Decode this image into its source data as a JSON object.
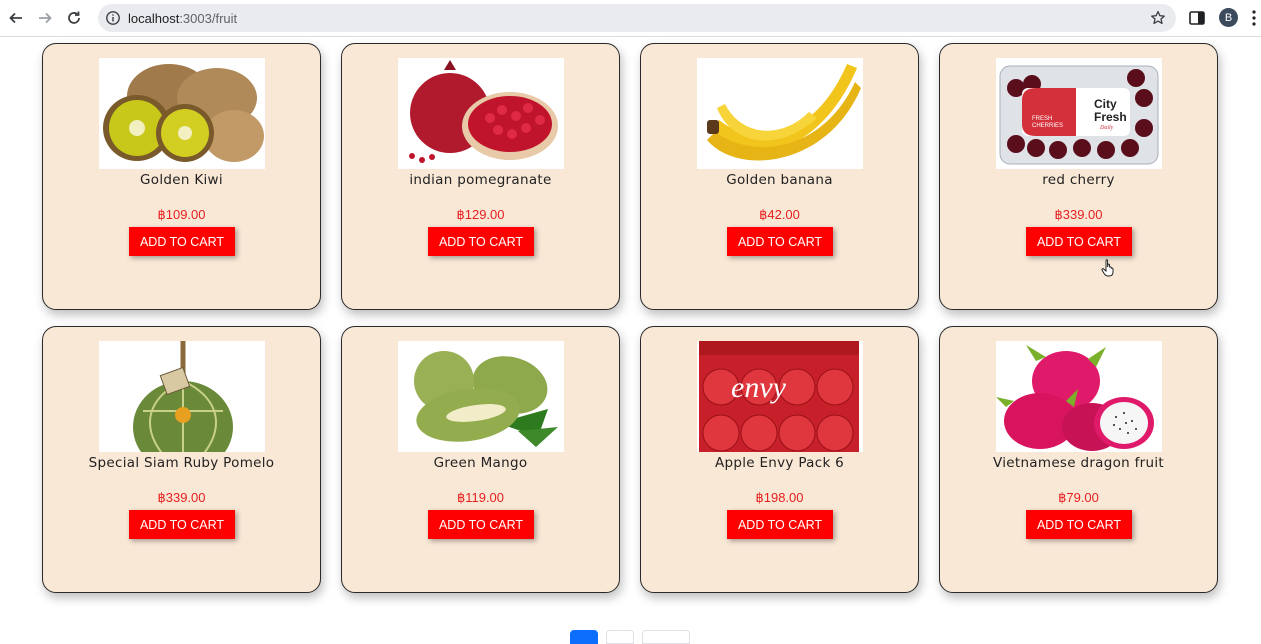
{
  "browser": {
    "url_host": "localhost",
    "url_rest": ":3003/fruit",
    "profile_initial": "B"
  },
  "products": [
    {
      "name": "Golden Kiwi",
      "price": "฿109.00",
      "button": "ADD TO CART",
      "image": "kiwi"
    },
    {
      "name": "indian pomegranate",
      "price": "฿129.00",
      "button": "ADD TO CART",
      "image": "pomegranate"
    },
    {
      "name": "Golden banana",
      "price": "฿42.00",
      "button": "ADD TO CART",
      "image": "banana"
    },
    {
      "name": "red cherry",
      "price": "฿339.00",
      "button": "ADD TO CART",
      "image": "cherry-pack"
    },
    {
      "name": "Special Siam Ruby Pomelo",
      "price": "฿339.00",
      "button": "ADD TO CART",
      "image": "pomelo"
    },
    {
      "name": "Green Mango",
      "price": "฿119.00",
      "button": "ADD TO CART",
      "image": "mango"
    },
    {
      "name": "Apple Envy Pack 6",
      "price": "฿198.00",
      "button": "ADD TO CART",
      "image": "apple-pack"
    },
    {
      "name": "Vietnamese dragon fruit",
      "price": "฿79.00",
      "button": "ADD TO CART",
      "image": "dragon-fruit"
    }
  ],
  "cherry_label": {
    "brand_line1": "City",
    "brand_line2": "Fresh",
    "brand_line3": "Daily",
    "tag_line1": "FRESH",
    "tag_line2": "CHERRIES"
  },
  "apple_label": {
    "brand": "envy"
  },
  "pagination": {
    "active_page": 1
  },
  "colors": {
    "card_bg": "#fae8d7",
    "button_bg": "#ff0000",
    "price": "#e62020",
    "page_active": "#0d6efd"
  }
}
